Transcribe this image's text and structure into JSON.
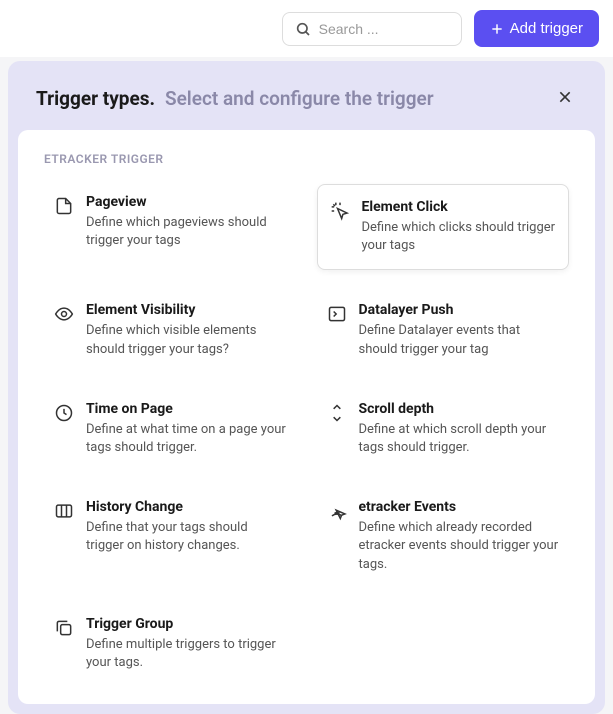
{
  "topbar": {
    "search_placeholder": "Search ...",
    "add_label": "Add trigger"
  },
  "modal": {
    "title": "Trigger types.",
    "subtitle": "Select and configure the trigger",
    "section_label": "ETRACKER TRIGGER"
  },
  "triggers": [
    {
      "title": "Pageview",
      "desc": "Define which pageviews should trigger your tags",
      "icon": "pageview",
      "selected": false
    },
    {
      "title": "Element Click",
      "desc": "Define which clicks should trigger your tags",
      "icon": "click",
      "selected": true
    },
    {
      "title": "Element Visibility",
      "desc": "Define which visible elements should trigger your tags?",
      "icon": "eye",
      "selected": false
    },
    {
      "title": "Datalayer Push",
      "desc": "Define Datalayer events that should trigger your tag",
      "icon": "terminal",
      "selected": false
    },
    {
      "title": "Time on Page",
      "desc": "Define at what time on a page your tags should trigger.",
      "icon": "clock",
      "selected": false
    },
    {
      "title": "Scroll depth",
      "desc": "Define at which scroll depth your tags should trigger.",
      "icon": "scroll",
      "selected": false
    },
    {
      "title": "History Change",
      "desc": "Define that your tags should trigger on history changes.",
      "icon": "columns",
      "selected": false
    },
    {
      "title": "etracker Events",
      "desc": "Define which already recorded etracker events should trigger your tags.",
      "icon": "broadcast",
      "selected": false
    },
    {
      "title": "Trigger Group",
      "desc": "Define multiple triggers to trigger your tags.",
      "icon": "copy",
      "selected": false
    }
  ]
}
